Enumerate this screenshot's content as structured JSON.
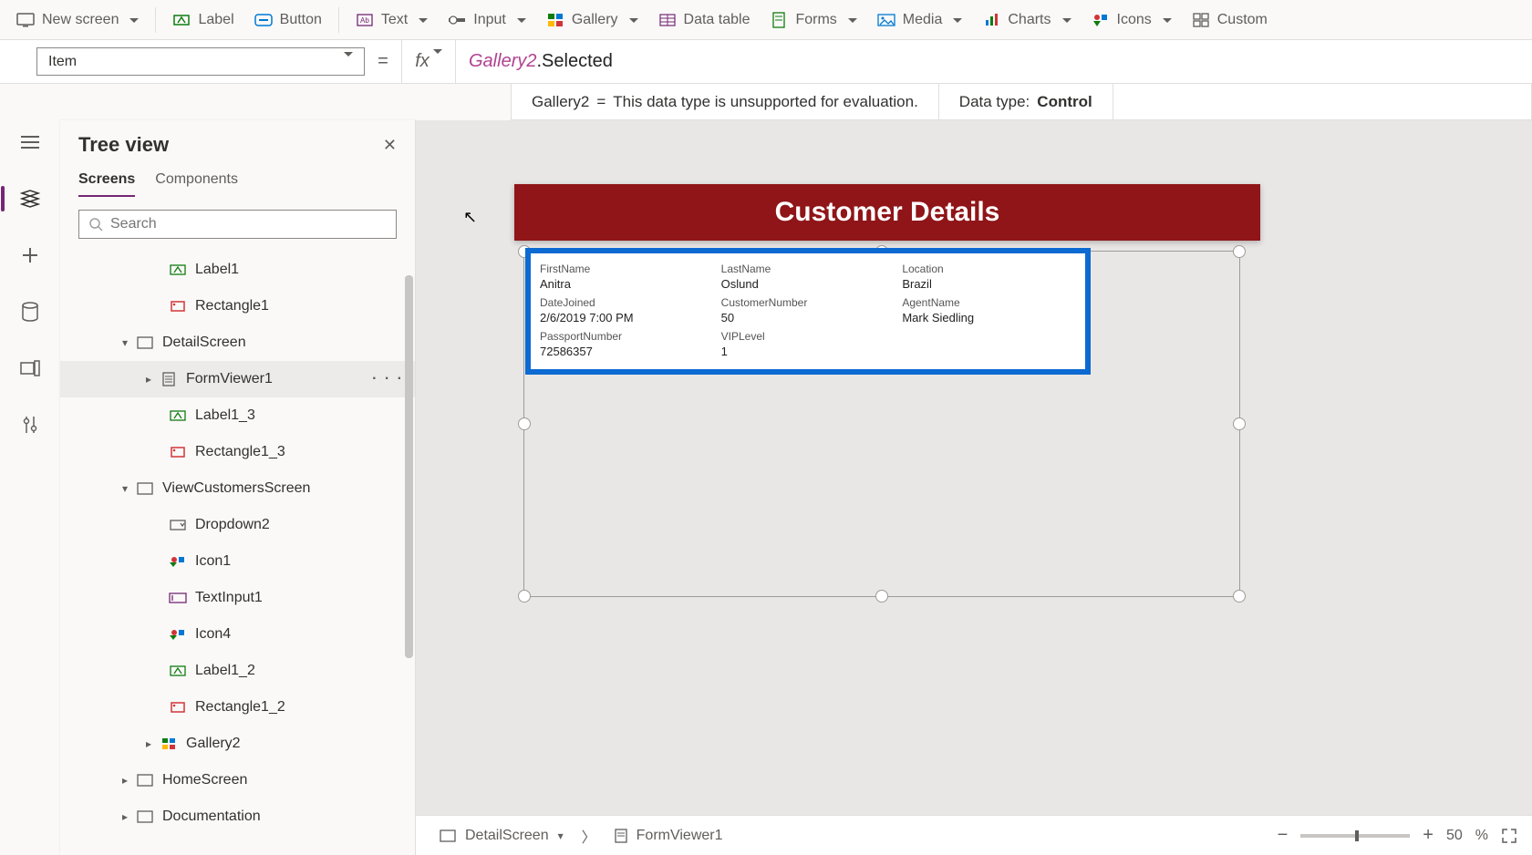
{
  "ribbon": {
    "newScreen": "New screen",
    "label": "Label",
    "button": "Button",
    "text": "Text",
    "input": "Input",
    "gallery": "Gallery",
    "dataTable": "Data table",
    "forms": "Forms",
    "media": "Media",
    "charts": "Charts",
    "icons": "Icons",
    "custom": "Custom"
  },
  "prop": {
    "name": "Item",
    "equals": "=",
    "fx": "fx",
    "formulaRef": "Gallery2",
    "formulaProp": ".Selected",
    "resultLeft": "Gallery2",
    "resultEq": "=",
    "resultMsg": "This data type is unsupported for evaluation.",
    "dataTypeLabel": "Data type:",
    "dataTypeValue": "Control"
  },
  "rail": {
    "menu": "≡",
    "tree": "layers",
    "add": "+",
    "data": "db",
    "media": "media",
    "advanced": "adv"
  },
  "treeview": {
    "title": "Tree view",
    "tabs": {
      "screens": "Screens",
      "components": "Components"
    },
    "searchPlaceholder": "Search",
    "nodes": [
      {
        "label": "Label1",
        "icon": "label",
        "indent": 1
      },
      {
        "label": "Rectangle1",
        "icon": "rect",
        "indent": 1
      },
      {
        "label": "DetailScreen",
        "icon": "screen",
        "indent": 0,
        "expander": "▾"
      },
      {
        "label": "FormViewer1",
        "icon": "form",
        "indent": 1,
        "expander": "▸",
        "selected": true,
        "more": "· · ·"
      },
      {
        "label": "Label1_3",
        "icon": "label",
        "indent": 1
      },
      {
        "label": "Rectangle1_3",
        "icon": "rect",
        "indent": 1
      },
      {
        "label": "ViewCustomersScreen",
        "icon": "screen",
        "indent": 0,
        "expander": "▾"
      },
      {
        "label": "Dropdown2",
        "icon": "dropdown",
        "indent": 1
      },
      {
        "label": "Icon1",
        "icon": "icon",
        "indent": 1
      },
      {
        "label": "TextInput1",
        "icon": "textinput",
        "indent": 1
      },
      {
        "label": "Icon4",
        "icon": "icon",
        "indent": 1
      },
      {
        "label": "Label1_2",
        "icon": "label",
        "indent": 1
      },
      {
        "label": "Rectangle1_2",
        "icon": "rect",
        "indent": 1
      },
      {
        "label": "Gallery2",
        "icon": "gallery",
        "indent": 1,
        "expander": "▸"
      },
      {
        "label": "HomeScreen",
        "icon": "screen",
        "indent": 0,
        "expander": "▸"
      },
      {
        "label": "Documentation",
        "icon": "screen",
        "indent": 0,
        "expander": "▸"
      }
    ]
  },
  "app": {
    "headerTitle": "Customer Details",
    "form": {
      "fields": [
        {
          "label": "FirstName",
          "value": "Anitra"
        },
        {
          "label": "LastName",
          "value": "Oslund"
        },
        {
          "label": "Location",
          "value": "Brazil"
        },
        {
          "label": "DateJoined",
          "value": "2/6/2019 7:00 PM"
        },
        {
          "label": "CustomerNumber",
          "value": "50"
        },
        {
          "label": "AgentName",
          "value": "Mark Siedling"
        },
        {
          "label": "PassportNumber",
          "value": "72586357"
        },
        {
          "label": "VIPLevel",
          "value": "1"
        }
      ]
    }
  },
  "breadcrumb": {
    "screen": "DetailScreen",
    "control": "FormViewer1"
  },
  "zoom": {
    "value": "50",
    "pct": "%"
  }
}
